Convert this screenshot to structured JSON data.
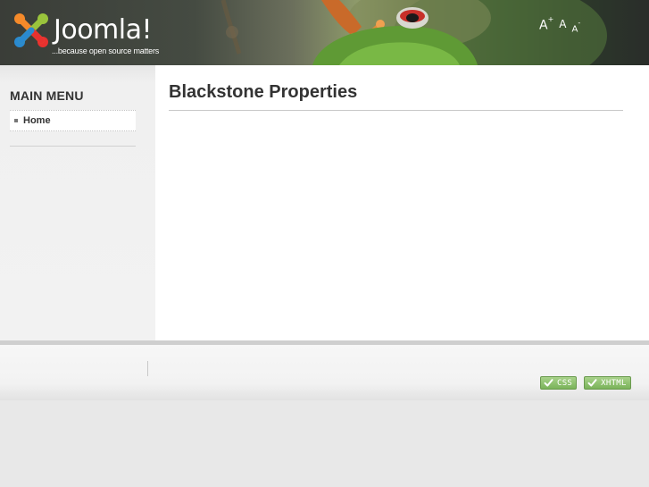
{
  "header": {
    "logo_text": "Joomla!",
    "logo_tagline": "...because open source matters",
    "font_tools": {
      "increase": "A",
      "increase_sign": "+",
      "reset": "A",
      "decrease": "A",
      "decrease_sign": "-"
    }
  },
  "sidebar": {
    "menu_title": "MAIN MENU",
    "items": [
      {
        "label": "Home"
      }
    ]
  },
  "main": {
    "title": "Blackstone Properties"
  },
  "footer": {
    "badges": [
      {
        "label": "CSS"
      },
      {
        "label": "XHTML"
      }
    ]
  },
  "colors": {
    "badge_green": "#7ab35a",
    "title_text": "#333333"
  }
}
